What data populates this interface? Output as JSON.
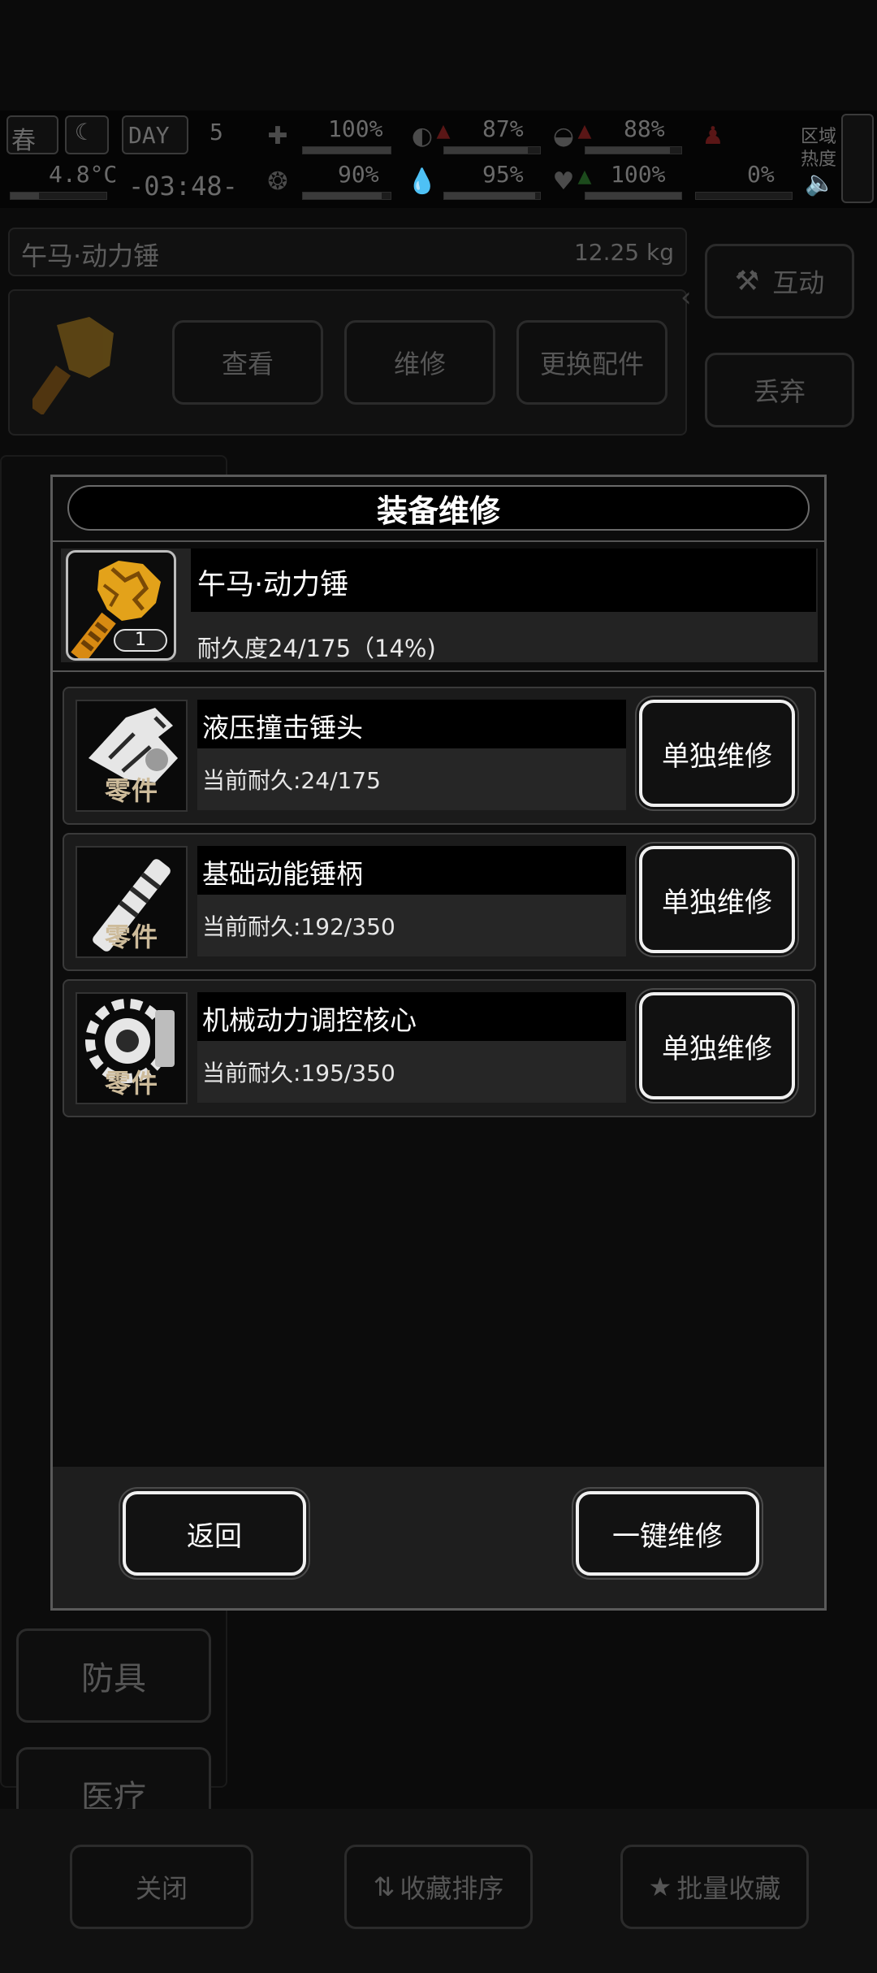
{
  "hud": {
    "season": "春",
    "day_label": "DAY",
    "day_number": "5",
    "temperature": "4.8°C",
    "clock": "-03:48-",
    "stats_row1": [
      "100%",
      "87%",
      "88%"
    ],
    "stats_row2": [
      "90%",
      "95%",
      "100%",
      "0%"
    ],
    "zone_label_1": "区域",
    "zone_label_2": "热度"
  },
  "background": {
    "item_title": "午马·动力锤",
    "item_weight": "12.25 kg",
    "btn_view": "查看",
    "btn_repair": "维修",
    "btn_replace": "更换配件",
    "btn_interact": "互动",
    "btn_discard": "丢弃",
    "cat_armor": "防具",
    "cat_medical": "医疗",
    "btn_close": "关闭",
    "btn_sort": "收藏排序",
    "btn_batch": "批量收藏"
  },
  "modal": {
    "title": "装备维修",
    "equipment": {
      "name": "午马·动力锤",
      "count": "1",
      "durability": "耐久度24/175（14%)"
    },
    "parts": [
      {
        "name": "液压撞击锤头",
        "durability": "当前耐久:24/175",
        "tag": "零件",
        "button": "单独维修",
        "icon": "hammer-head-icon"
      },
      {
        "name": "基础动能锤柄",
        "durability": "当前耐久:192/350",
        "tag": "零件",
        "button": "单独维修",
        "icon": "hammer-handle-icon"
      },
      {
        "name": "机械动力调控核心",
        "durability": "当前耐久:195/350",
        "tag": "零件",
        "button": "单独维修",
        "icon": "gear-core-icon"
      }
    ],
    "back_button": "返回",
    "repair_all_button": "一键维修"
  },
  "colors": {
    "accent_gold": "#e3a21a",
    "button_border": "#f0f0f0",
    "modal_border": "#5a5a5a"
  }
}
